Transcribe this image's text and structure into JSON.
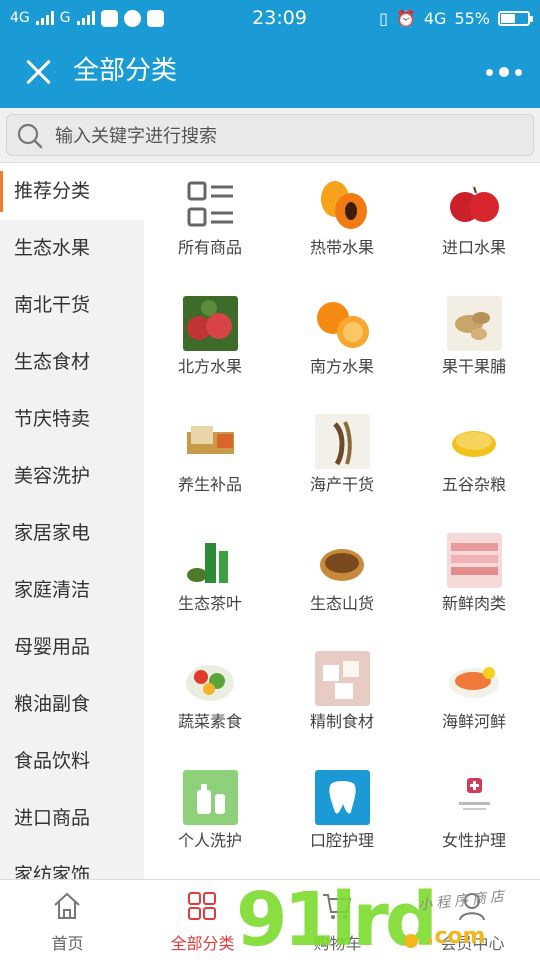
{
  "status_bar": {
    "signal1": "4G",
    "signal2": "G",
    "time": "23:09",
    "network": "4G",
    "battery": "55%",
    "battery_level": 0.55
  },
  "header": {
    "title": "全部分类"
  },
  "search": {
    "placeholder": "输入关键字进行搜索"
  },
  "sidebar": {
    "items": [
      {
        "label": "推荐分类",
        "active": true
      },
      {
        "label": "生态水果"
      },
      {
        "label": "南北干货"
      },
      {
        "label": "生态食材"
      },
      {
        "label": "节庆特卖"
      },
      {
        "label": "美容洗护"
      },
      {
        "label": "家居家电"
      },
      {
        "label": "家庭清洁"
      },
      {
        "label": "母婴用品"
      },
      {
        "label": "粮油副食"
      },
      {
        "label": "食品饮料"
      },
      {
        "label": "进口商品"
      },
      {
        "label": "家纺家饰"
      }
    ]
  },
  "categories": [
    {
      "label": "所有商品",
      "icon": "grid-list-icon"
    },
    {
      "label": "热带水果",
      "icon": "papaya-image"
    },
    {
      "label": "进口水果",
      "icon": "apples-image"
    },
    {
      "label": "北方水果",
      "icon": "apple-tree-image"
    },
    {
      "label": "南方水果",
      "icon": "oranges-image"
    },
    {
      "label": "果干果脯",
      "icon": "ginger-image"
    },
    {
      "label": "养生补品",
      "icon": "gift-box-image"
    },
    {
      "label": "海产干货",
      "icon": "dried-seafood-image"
    },
    {
      "label": "五谷杂粮",
      "icon": "millet-image"
    },
    {
      "label": "生态茶叶",
      "icon": "tea-image"
    },
    {
      "label": "生态山货",
      "icon": "mountain-goods-image"
    },
    {
      "label": "新鲜肉类",
      "icon": "pork-image"
    },
    {
      "label": "蔬菜素食",
      "icon": "vegetables-image"
    },
    {
      "label": "精制食材",
      "icon": "tofu-image"
    },
    {
      "label": "海鲜河鲜",
      "icon": "seafood-plate-image"
    },
    {
      "label": "个人洗护",
      "icon": "toiletries-image"
    },
    {
      "label": "口腔护理",
      "icon": "tooth-image"
    },
    {
      "label": "女性护理",
      "icon": "feminine-care-image"
    }
  ],
  "bottom_nav": [
    {
      "label": "首页",
      "icon": "home-icon"
    },
    {
      "label": "全部分类",
      "icon": "category-grid-icon",
      "active": true
    },
    {
      "label": "购物车",
      "icon": "cart-icon"
    },
    {
      "label": "会员中心",
      "icon": "user-icon"
    }
  ],
  "watermark": {
    "big": "91lrd",
    "small": "小程序商店",
    "suffix": ".com"
  },
  "colors": {
    "header_bg": "#1b9bd6",
    "active_accent": "#f57b2c",
    "nav_active": "#e23b3b"
  }
}
